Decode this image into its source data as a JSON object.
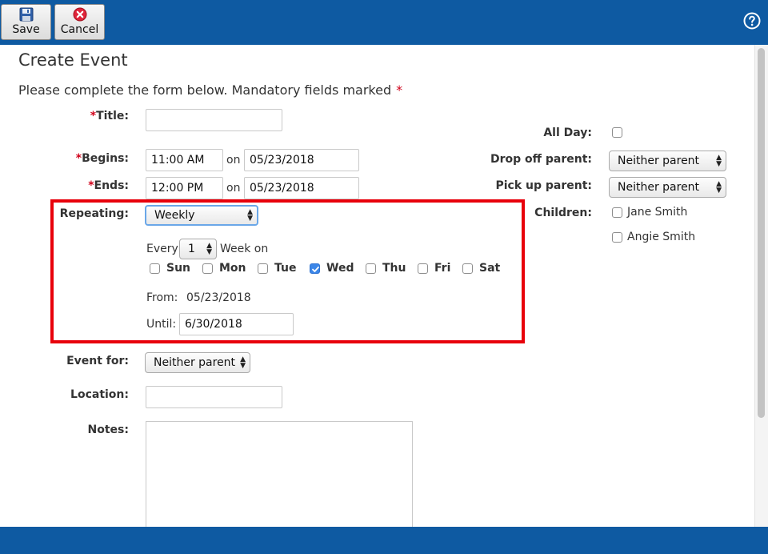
{
  "toolbar": {
    "save_label": "Save",
    "cancel_label": "Cancel",
    "help_icon": "help-icon"
  },
  "colors": {
    "toolbar_bg": "#0e5aa2",
    "required": "#d0021b",
    "highlight": "#e8000b",
    "checkbox_checked": "#3b86e8"
  },
  "page": {
    "title": "Create Event",
    "instructions": "Please complete the form below. Mandatory fields marked",
    "required_marker": "*"
  },
  "form": {
    "title_label": "Title:",
    "title_value": "",
    "begins_label": "Begins:",
    "begins_time": "11:00 AM",
    "begins_on": "on",
    "begins_date": "05/23/2018",
    "ends_label": "Ends:",
    "ends_time": "12:00 PM",
    "ends_on": "on",
    "ends_date": "05/23/2018",
    "repeating_label": "Repeating:",
    "repeating_value": "Weekly",
    "every_label": "Every",
    "every_value": "1",
    "week_on_label": "Week on",
    "days": [
      {
        "label": "Sun",
        "checked": false
      },
      {
        "label": "Mon",
        "checked": false
      },
      {
        "label": "Tue",
        "checked": false
      },
      {
        "label": "Wed",
        "checked": true
      },
      {
        "label": "Thu",
        "checked": false
      },
      {
        "label": "Fri",
        "checked": false
      },
      {
        "label": "Sat",
        "checked": false
      }
    ],
    "from_label": "From:",
    "from_value": "05/23/2018",
    "until_label": "Until:",
    "until_value": "6/30/2018",
    "event_for_label": "Event for:",
    "event_for_value": "Neither parent",
    "location_label": "Location:",
    "location_value": "",
    "notes_label": "Notes:",
    "notes_value": "",
    "all_day_label": "All Day:",
    "all_day_checked": false,
    "drop_off_label": "Drop off parent:",
    "drop_off_value": "Neither parent",
    "pick_up_label": "Pick up parent:",
    "pick_up_value": "Neither parent",
    "children_label": "Children:",
    "children": [
      {
        "name": "Jane Smith",
        "checked": false
      },
      {
        "name": "Angie Smith",
        "checked": false
      }
    ]
  }
}
